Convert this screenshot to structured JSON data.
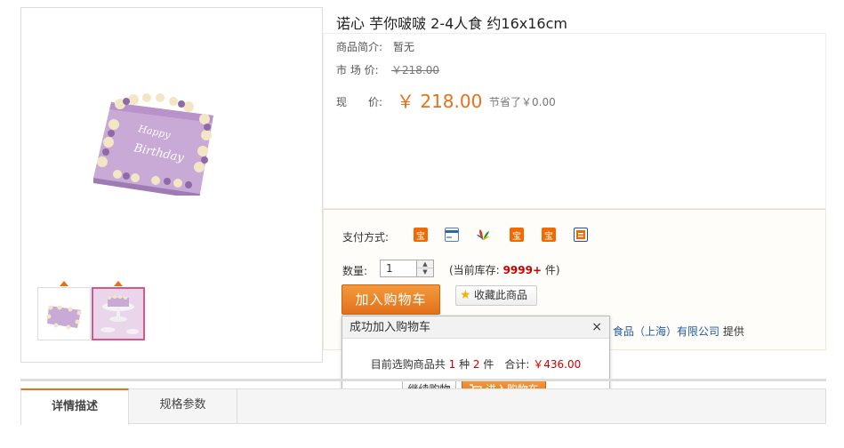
{
  "product": {
    "title": "诺心 芋你啵啵 2-4人食 约16x16cm",
    "intro_label": "商品简介:",
    "intro_value": "暂无",
    "market_label": "市 场 价:",
    "market_price": "￥218.00",
    "now_label": "现　　价:",
    "now_price": "￥ 218.00",
    "saved": "节省了￥0.00"
  },
  "purchase": {
    "pay_label": "支付方式:",
    "pay_icons": [
      "alipay-icon",
      "bank-card-icon",
      "unionpay-icon",
      "alipay-icon",
      "alipay-icon",
      "cod-icon"
    ],
    "qty_label": "数量:",
    "qty_value": "1",
    "stock_prefix": "(当前库存:",
    "stock_count": "9999+",
    "stock_suffix": "件)",
    "add_to_cart": "加入购物车",
    "favorite": "收藏此商品",
    "supplier_name": "食品（上海）有限公司",
    "supplier_suffix": "提供"
  },
  "popup": {
    "title": "成功加入购物车",
    "close": "×",
    "msg_prefix": "目前选购商品共",
    "kinds": "1",
    "kinds_unit": "种",
    "items": "2",
    "items_unit": "件　合计:",
    "total": "￥436.00",
    "continue": "继续购物",
    "go_cart": "进入购物车"
  },
  "tabs": [
    "详情描述",
    "规格参数"
  ],
  "colors": {
    "accent": "#e8701a",
    "price": "#e8701a",
    "stock": "#cc0000"
  }
}
